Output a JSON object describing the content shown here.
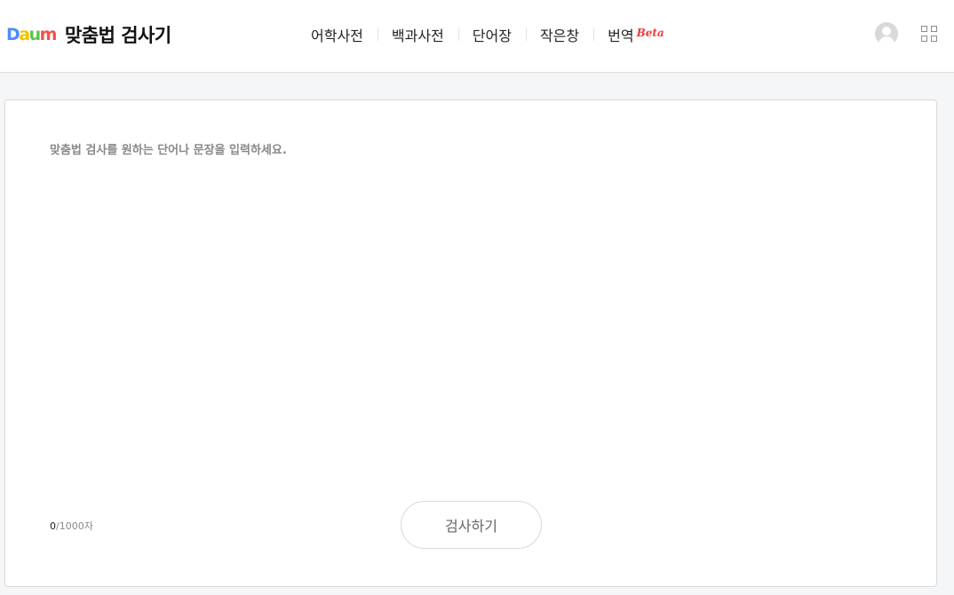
{
  "header": {
    "logo": {
      "letters": [
        {
          "char": "D",
          "color": "#4c8df6"
        },
        {
          "char": "a",
          "color": "#f7c000"
        },
        {
          "char": "u",
          "color": "#5ac34e"
        },
        {
          "char": "m",
          "color": "#ee5247"
        }
      ],
      "title": "맞춤법 검사기"
    },
    "nav": [
      {
        "label": "어학사전"
      },
      {
        "label": "백과사전"
      },
      {
        "label": "단어장"
      },
      {
        "label": "작은창"
      },
      {
        "label": "번역",
        "badge": "Beta"
      }
    ],
    "icons": {
      "profile": "user-avatar-icon",
      "apps": "app-grid-icon"
    }
  },
  "editor": {
    "placeholder": "맞춤법 검사를 원하는 단어나 문장을 입력하세요.",
    "value": "",
    "count": {
      "current": "0",
      "max": "/1000자"
    },
    "submit_label": "검사하기"
  },
  "colors": {
    "accent": "#ee3b36",
    "background": "#f5f6f7"
  }
}
